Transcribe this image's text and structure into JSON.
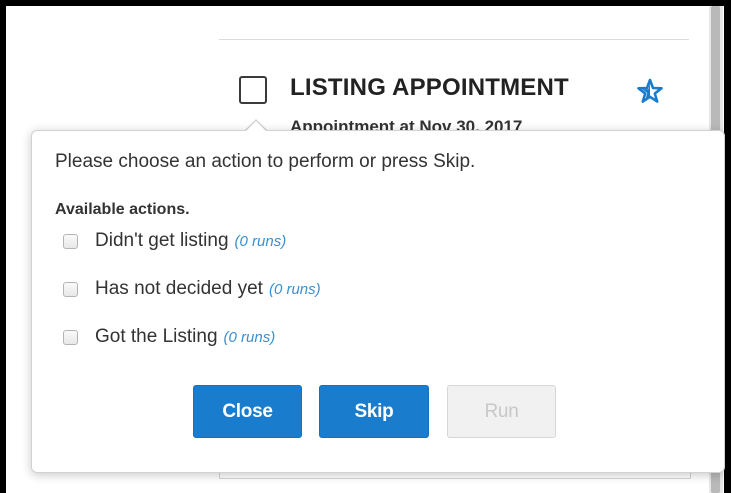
{
  "task": {
    "title": "LISTING APPOINTMENT",
    "subtitle": "Appointment at Nov 30, 2017"
  },
  "dialog": {
    "prompt": "Please choose an action to perform or press Skip.",
    "actions_heading": "Available actions.",
    "actions": [
      {
        "label": "Didn't get listing",
        "runs": "(0 runs)",
        "checked": false
      },
      {
        "label": "Has not decided yet",
        "runs": "(0 runs)",
        "checked": false
      },
      {
        "label": "Got the Listing",
        "runs": "(0 runs)",
        "checked": false
      }
    ],
    "buttons": {
      "close": "Close",
      "skip": "Skip",
      "run": "Run"
    }
  },
  "icons": {
    "star": "star-outline-icon",
    "task_checkbox": "checkbox-empty-icon"
  },
  "colors": {
    "accent": "#1a7ccd",
    "runs_link": "#3a8fd0",
    "disabled_text": "#c7c7c7"
  }
}
